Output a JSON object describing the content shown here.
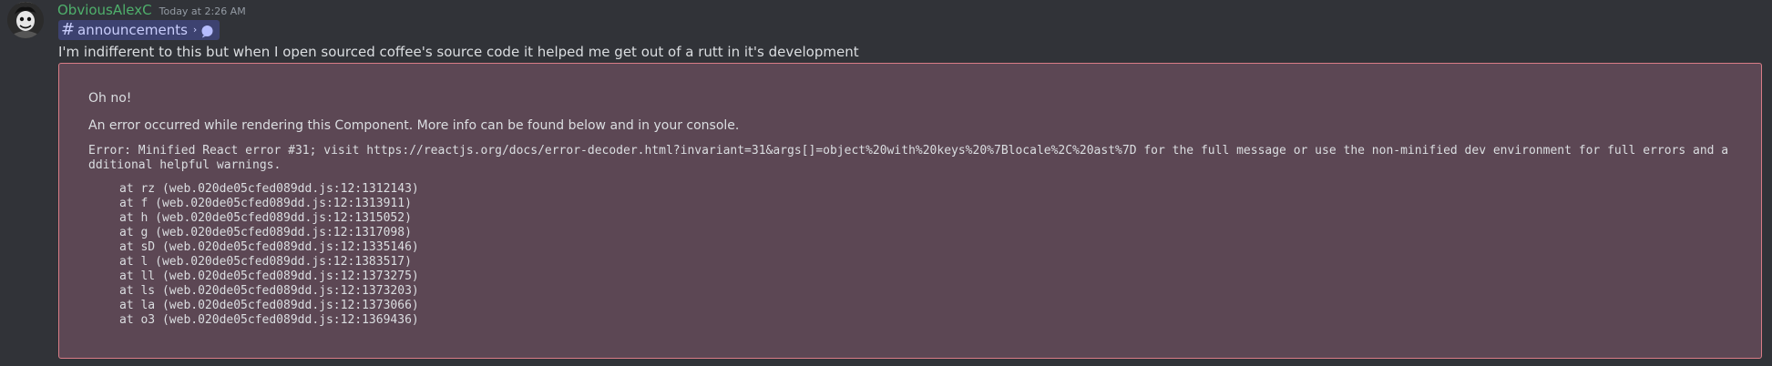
{
  "message": {
    "username": "ObviousAlexC",
    "timestamp": "Today at 2:26 AM",
    "channel_mention": {
      "icon": "hash-icon",
      "name": "announcements",
      "chevron": "›",
      "bubble_icon": "chat-bubble-icon"
    },
    "text": "I'm indifferent to this but when I open sourced coffee's source code it helped me get out of a rutt in it's development"
  },
  "error": {
    "title": "Oh no!",
    "description": "An error occurred while rendering this Component. More info can be found below and in your console.",
    "message": "Error: Minified React error #31; visit https://reactjs.org/docs/error-decoder.html?invariant=31&args[]=object%20with%20keys%20%7Blocale%2C%20ast%7D for the full message or use the non-minified dev environment for full errors and additional helpful warnings.",
    "stack": [
      "at rz (web.020de05cfed089dd.js:12:1312143)",
      "at f (web.020de05cfed089dd.js:12:1313911)",
      "at h (web.020de05cfed089dd.js:12:1315052)",
      "at g (web.020de05cfed089dd.js:12:1317098)",
      "at sD (web.020de05cfed089dd.js:12:1335146)",
      "at l (web.020de05cfed089dd.js:12:1383517)",
      "at ll (web.020de05cfed089dd.js:12:1373275)",
      "at ls (web.020de05cfed089dd.js:12:1373203)",
      "at la (web.020de05cfed089dd.js:12:1373066)",
      "at o3 (web.020de05cfed089dd.js:12:1369436)"
    ]
  },
  "colors": {
    "background": "#313338",
    "username": "#4fb06c",
    "mention_bg": "#3d4270",
    "error_bg": "#5c4754",
    "error_border": "#d97c86"
  }
}
